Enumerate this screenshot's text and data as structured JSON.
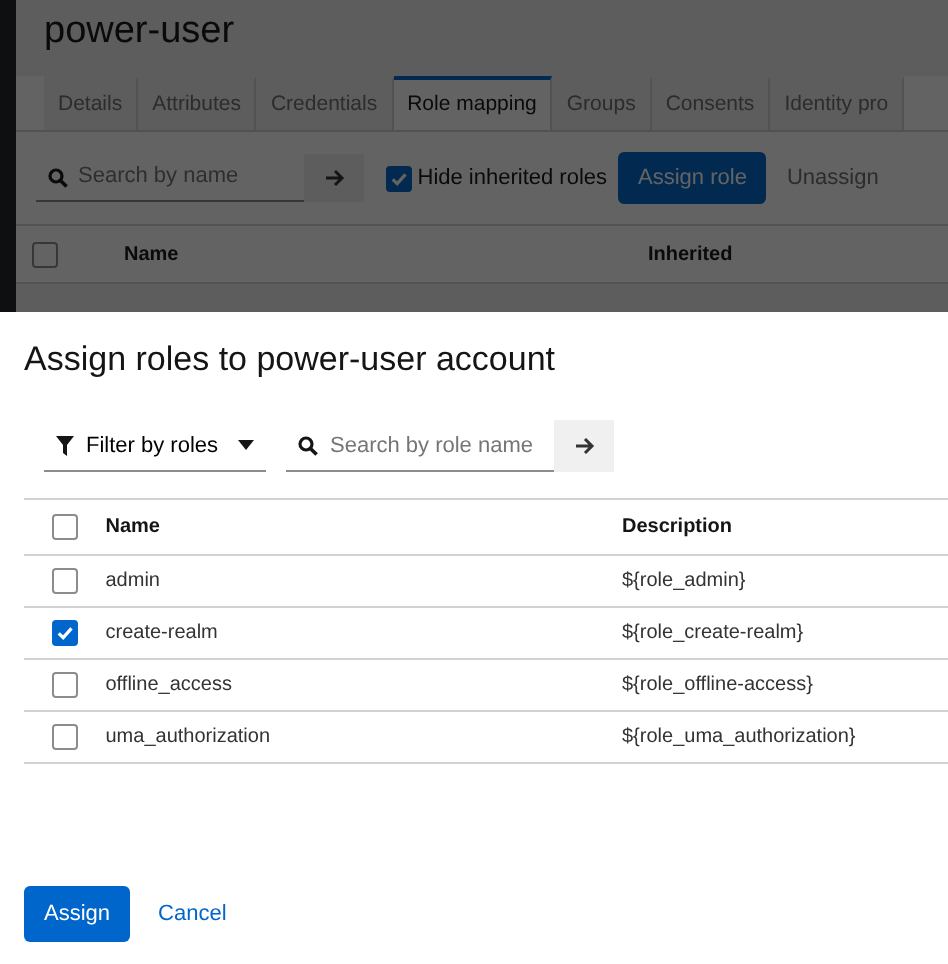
{
  "page": {
    "title": "power-user",
    "tabs": [
      {
        "label": "Details",
        "selected": false
      },
      {
        "label": "Attributes",
        "selected": false
      },
      {
        "label": "Credentials",
        "selected": false
      },
      {
        "label": "Role mapping",
        "selected": true
      },
      {
        "label": "Groups",
        "selected": false
      },
      {
        "label": "Consents",
        "selected": false
      },
      {
        "label": "Identity pro",
        "selected": false
      }
    ],
    "search": {
      "placeholder": "Search by name"
    },
    "hide_inherited": {
      "label": "Hide inherited roles",
      "checked": true
    },
    "buttons": [
      {
        "label": "Assign role",
        "kind": "primary"
      },
      {
        "label": "Unassign",
        "kind": "plain"
      }
    ],
    "table": {
      "select_all_checked": false,
      "columns": [
        "Name",
        "Inherited"
      ]
    }
  },
  "dialog": {
    "title": "Assign roles to power-user account",
    "filter": {
      "label": "Filter by roles"
    },
    "search": {
      "placeholder": "Search by role name"
    },
    "table": {
      "select_all_checked": false,
      "columns": [
        "Name",
        "Description"
      ],
      "rows": [
        {
          "name": "admin",
          "description": "${role_admin}",
          "checked": false
        },
        {
          "name": "create-realm",
          "description": "${role_create-realm}",
          "checked": true
        },
        {
          "name": "offline_access",
          "description": "${role_offline-access}",
          "checked": false
        },
        {
          "name": "uma_authorization",
          "description": "${role_uma_authorization}",
          "checked": false
        }
      ]
    },
    "buttons": [
      {
        "label": "Assign",
        "kind": "primary"
      },
      {
        "label": "Cancel",
        "kind": "link"
      }
    ]
  }
}
